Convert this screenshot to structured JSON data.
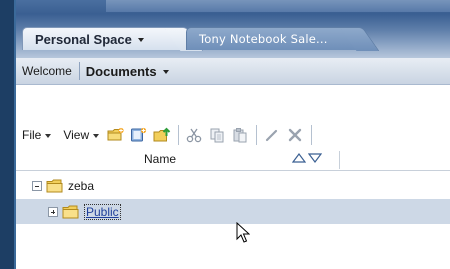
{
  "tabs": [
    {
      "label": "Personal Space",
      "active": true
    },
    {
      "label": "Tony Notebook Sale...",
      "active": false
    }
  ],
  "subnav": {
    "welcome_label": "Welcome",
    "documents_label": "Documents"
  },
  "toolbar": {
    "file_label": "File",
    "view_label": "View",
    "icons": [
      "new-folder-icon",
      "new-document-icon",
      "upload-icon",
      "cut-icon",
      "copy-icon",
      "paste-icon",
      "edit-icon",
      "delete-icon"
    ]
  },
  "table": {
    "column_name_label": "Name"
  },
  "tree": [
    {
      "label": "zeba",
      "expanded": true,
      "selected": false
    },
    {
      "label": "Public",
      "expanded": false,
      "selected": true
    }
  ],
  "colors": {
    "accent": "#1d3e64",
    "selection": "#cdd8e6",
    "link": "#1f3f9a"
  }
}
